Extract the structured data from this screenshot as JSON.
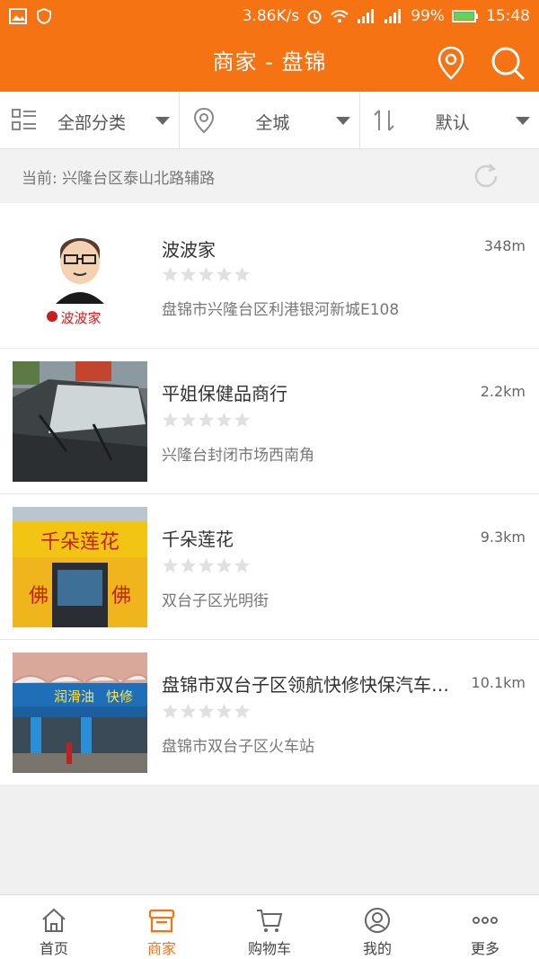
{
  "status_bar": {
    "speed": "3.86K/s",
    "battery": "99%",
    "time": "15:48"
  },
  "app_bar": {
    "title": "商家 - 盘锦"
  },
  "filters": [
    {
      "label": "全部分类",
      "icon": "grid-list-icon"
    },
    {
      "label": "全城",
      "icon": "location-pin-icon"
    },
    {
      "label": "默认",
      "icon": "sort-icon"
    }
  ],
  "location": {
    "text": "当前: 兴隆台区泰山北路辅路"
  },
  "merchants": [
    {
      "name": "波波家",
      "distance": "348m",
      "address": "盘锦市兴隆台区利港银河新城E108",
      "rating": 0,
      "logo_text": "波波家"
    },
    {
      "name": "平姐保健品商行",
      "distance": "2.2km",
      "address": "兴隆台封闭市场西南角",
      "rating": 0
    },
    {
      "name": "千朵莲花",
      "distance": "9.3km",
      "address": "双台子区光明街",
      "rating": 0,
      "sign_text": "千朵莲花"
    },
    {
      "name": "盘锦市双台子区领航快修快保汽车…",
      "distance": "10.1km",
      "address": "盘锦市双台子区火车站",
      "rating": 0,
      "sign_text": "润滑油"
    }
  ],
  "tabs": [
    {
      "label": "首页",
      "icon": "home-icon",
      "active": false
    },
    {
      "label": "商家",
      "icon": "store-icon",
      "active": true
    },
    {
      "label": "购物车",
      "icon": "cart-icon",
      "active": false
    },
    {
      "label": "我的",
      "icon": "user-icon",
      "active": false
    },
    {
      "label": "更多",
      "icon": "more-icon",
      "active": false
    }
  ],
  "colors": {
    "accent": "#f57313",
    "star_empty": "#e0e0e0"
  }
}
